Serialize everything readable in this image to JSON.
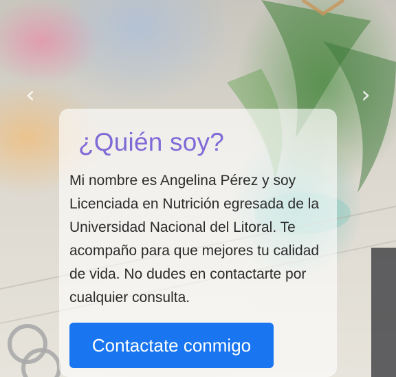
{
  "carousel": {
    "prev_icon": "chevron-left-icon",
    "next_icon": "chevron-right-icon",
    "prev_glyph": "‹",
    "next_glyph": "›"
  },
  "about": {
    "title": "¿Quién soy?",
    "text": "Mi nombre es Angelina Pérez y soy Licenciada en Nutrición egresada de la Universidad Nacional del Litoral. Te acompaño para que mejores tu calidad de vida. No dudes en contactarte por cualquier consulta.",
    "button_label": "Contactate conmigo"
  },
  "colors": {
    "title": "#7f6ad6",
    "button": "#1976f0"
  }
}
